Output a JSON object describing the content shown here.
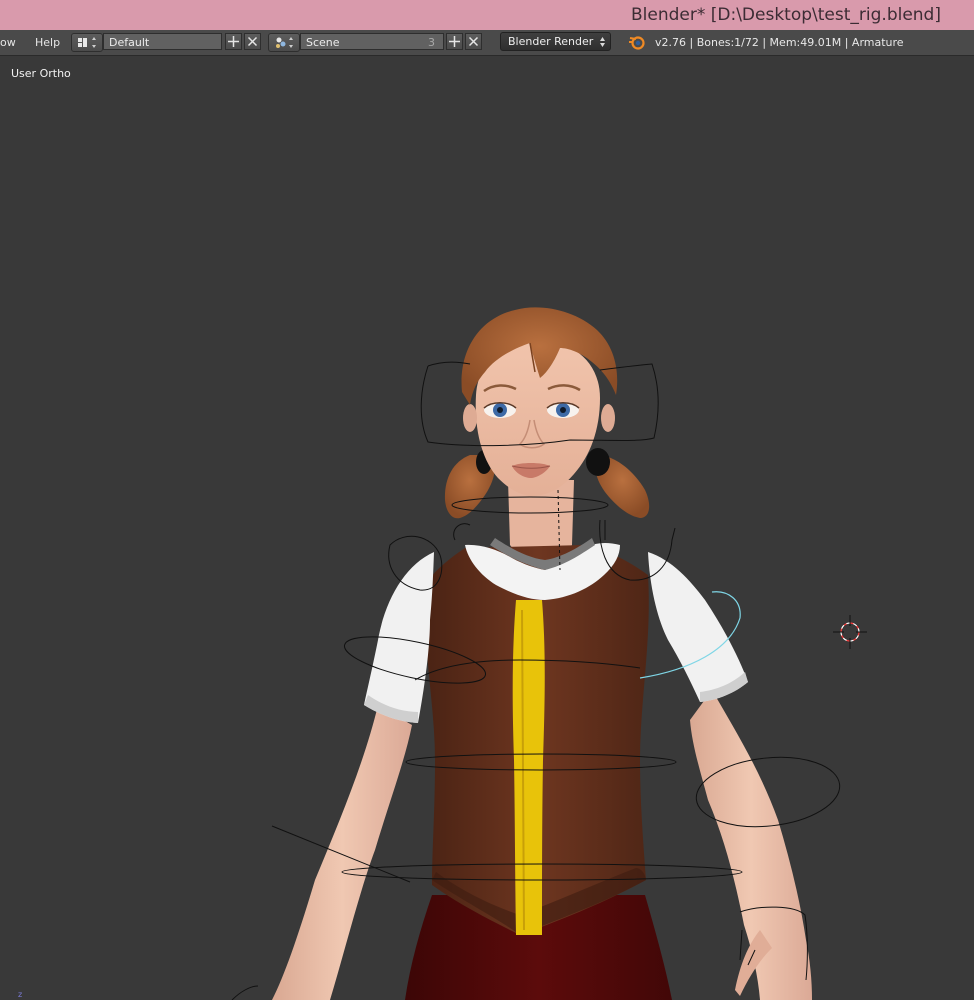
{
  "window": {
    "title": "Blender* [D:\\Desktop\\test_rig.blend]"
  },
  "header": {
    "menus": [
      "ow",
      "Help"
    ],
    "screen_layout": "Default",
    "scene": "Scene",
    "scene_users": "3",
    "render_engine": "Blender Render",
    "info": "v2.76 | Bones:1/72  | Mem:49.01M | Armature"
  },
  "viewport": {
    "view_label": "User Ortho",
    "axis_indicator": "z"
  },
  "colors": {
    "titlebar": "#d99aac",
    "header": "#4a4a4a",
    "viewport_bg": "#393939",
    "selected_bone": "#7fd6e6"
  },
  "icons": [
    "screen-layout-icon",
    "scene-icon",
    "plus-icon",
    "close-icon",
    "blender-logo-icon",
    "cursor-3d-icon"
  ]
}
